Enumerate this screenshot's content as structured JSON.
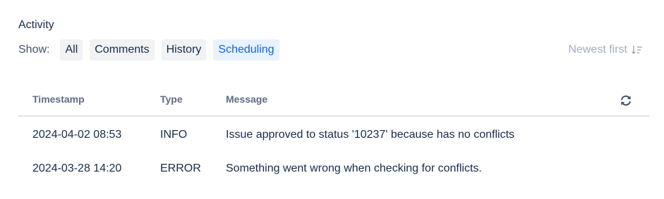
{
  "activity": {
    "title": "Activity",
    "show_label": "Show:",
    "filters": [
      {
        "label": "All",
        "selected": false
      },
      {
        "label": "Comments",
        "selected": false
      },
      {
        "label": "History",
        "selected": false
      },
      {
        "label": "Scheduling",
        "selected": true
      }
    ],
    "sort": {
      "label": "Newest first",
      "icon": "sort-descending-icon"
    }
  },
  "table": {
    "columns": {
      "timestamp": "Timestamp",
      "type": "Type",
      "message": "Message"
    },
    "refresh_icon": "refresh-icon",
    "rows": [
      {
        "timestamp": "2024-04-02 08:53",
        "type": "INFO",
        "message": "Issue approved to status '10237' because has no conflicts"
      },
      {
        "timestamp": "2024-03-28 14:20",
        "type": "ERROR",
        "message": "Something went wrong when checking for conflicts."
      }
    ]
  },
  "colors": {
    "text": "#172b4d",
    "muted": "#44546f",
    "selected_bg": "#e9f2ff",
    "selected_text": "#0c66e4",
    "button_bg": "#f1f2f4",
    "disabled": "#a5adba"
  }
}
